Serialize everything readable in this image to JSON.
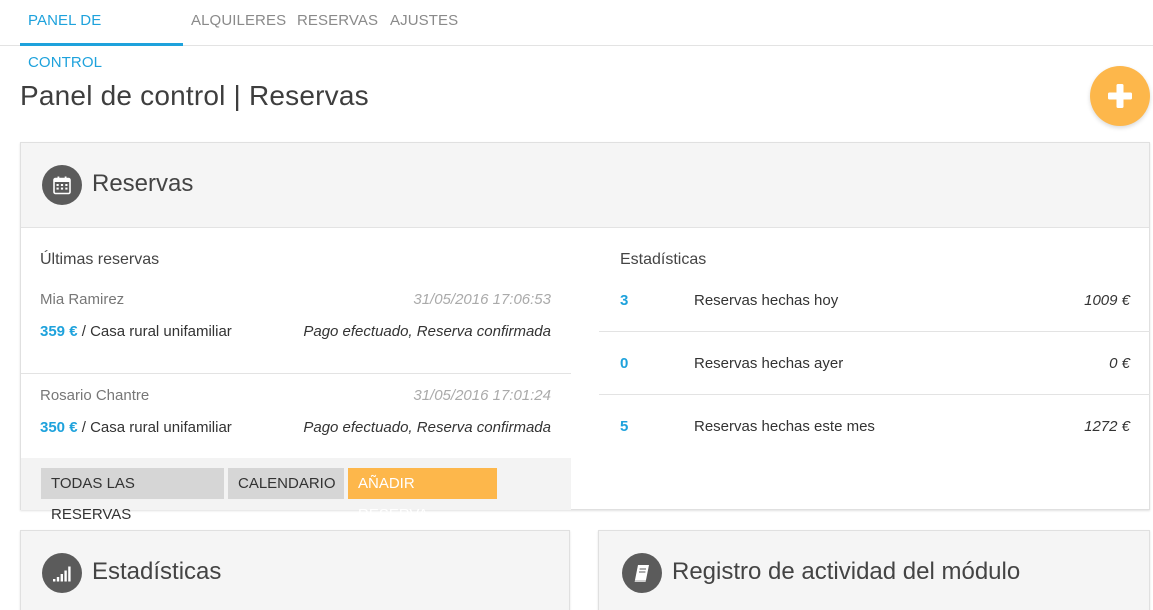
{
  "nav": {
    "tabs": [
      {
        "label": "PANEL DE CONTROL",
        "active": true
      },
      {
        "label": "ALQUILERES",
        "active": false
      },
      {
        "label": "RESERVAS",
        "active": false
      },
      {
        "label": "AJUSTES",
        "active": false
      }
    ]
  },
  "page": {
    "title": "Panel de control | Reservas",
    "fab_icon": "plus-icon"
  },
  "reservas_card": {
    "title": "Reservas",
    "icon": "calendar-icon",
    "latest": {
      "title": "Últimas reservas",
      "items": [
        {
          "name": "Mia Ramirez",
          "date": "31/05/2016 17:06:53",
          "price": "359 €",
          "separator": " / ",
          "property": "Casa rural unifamiliar",
          "status": "Pago efectuado, Reserva confirmada"
        },
        {
          "name": "Rosario Chantre",
          "date": "31/05/2016 17:01:24",
          "price": "350 €",
          "separator": " / ",
          "property": "Casa rural unifamiliar",
          "status": "Pago efectuado, Reserva confirmada"
        }
      ]
    },
    "actions": {
      "all": "TODAS LAS RESERVAS",
      "calendar": "CALENDARIO",
      "add": "AÑADIR RESERVA"
    },
    "stats": {
      "title": "Estadísticas",
      "rows": [
        {
          "count": "3",
          "label": "Reservas hechas hoy",
          "amount": "1009 €"
        },
        {
          "count": "0",
          "label": "Reservas hechas ayer",
          "amount": "0 €"
        },
        {
          "count": "5",
          "label": "Reservas hechas este mes",
          "amount": "1272 €"
        }
      ]
    }
  },
  "bottom_cards": [
    {
      "title": "Estadísticas",
      "icon": "signal-bars-icon"
    },
    {
      "title": "Registro de actividad del módulo",
      "icon": "book-icon"
    }
  ],
  "colors": {
    "accent_blue": "#1ea2dc",
    "accent_orange": "#fdb74b",
    "icon_grey": "#5b5b5b"
  }
}
